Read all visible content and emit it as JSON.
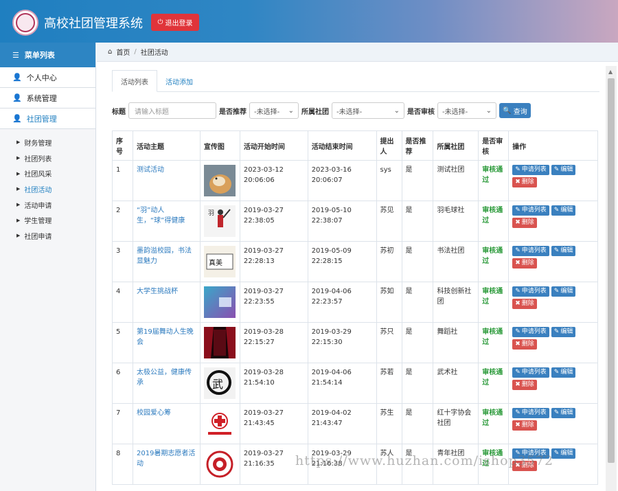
{
  "app": {
    "title": "高校社团管理系统",
    "logout_label": "退出登录"
  },
  "sidebar": {
    "header": "菜单列表",
    "groups": [
      {
        "label": "个人中心"
      },
      {
        "label": "系统管理"
      },
      {
        "label": "社团管理"
      }
    ],
    "sub_items": [
      "财务管理",
      "社团列表",
      "社团风采",
      "社团活动",
      "活动申请",
      "学生管理",
      "社团申请"
    ]
  },
  "breadcrumb": {
    "home": "首页",
    "current": "社团活动"
  },
  "tabs": [
    "活动列表",
    "活动添加"
  ],
  "filters": {
    "title_label": "标题",
    "title_placeholder": "请输入标题",
    "recommend_label": "是否推荐",
    "recommend_value": "-未选择-",
    "club_label": "所属社团",
    "club_value": "-未选择-",
    "audit_label": "是否审核",
    "audit_value": "-未选择-",
    "query_label": "查询"
  },
  "table": {
    "headers": [
      "序号",
      "活动主题",
      "宣传图",
      "活动开始时间",
      "活动结束时间",
      "提出人",
      "是否推荐",
      "所属社团",
      "是否审核",
      "操作"
    ],
    "rows": [
      {
        "no": "1",
        "topic": "测试活动",
        "start": "2023-03-12 20:06:06",
        "end": "2023-03-16 20:06:07",
        "proposer": "sys",
        "recommend": "是",
        "club": "测试社团",
        "audit": "审核通过"
      },
      {
        "no": "2",
        "topic": "“羽”动人生，“球”得健康",
        "start": "2019-03-27 22:38:05",
        "end": "2019-05-10 22:38:07",
        "proposer": "苏见",
        "recommend": "是",
        "club": "羽毛球社",
        "audit": "审核通过"
      },
      {
        "no": "3",
        "topic": "墨韵溢校园，书法显魅力",
        "start": "2019-03-27 22:28:13",
        "end": "2019-05-09 22:28:15",
        "proposer": "苏初",
        "recommend": "是",
        "club": "书法社团",
        "audit": "审核通过"
      },
      {
        "no": "4",
        "topic": "大学生挑战杯",
        "start": "2019-03-27 22:23:55",
        "end": "2019-04-06 22:23:57",
        "proposer": "苏如",
        "recommend": "是",
        "club": "科技创新社团",
        "audit": "审核通过"
      },
      {
        "no": "5",
        "topic": "第19届舞动人生晚会",
        "start": "2019-03-28 22:15:27",
        "end": "2019-03-29 22:15:30",
        "proposer": "苏只",
        "recommend": "是",
        "club": "舞蹈社",
        "audit": "审核通过"
      },
      {
        "no": "6",
        "topic": "太极公益，健康传承",
        "start": "2019-03-28 21:54:10",
        "end": "2019-04-06 21:54:14",
        "proposer": "苏若",
        "recommend": "是",
        "club": "武术社",
        "audit": "审核通过"
      },
      {
        "no": "7",
        "topic": "校园爱心筹",
        "start": "2019-03-27 21:43:45",
        "end": "2019-04-02 21:43:47",
        "proposer": "苏生",
        "recommend": "是",
        "club": "红十字协会社团",
        "audit": "审核通过"
      },
      {
        "no": "8",
        "topic": "2019暑期志愿者活动",
        "start": "2019-03-27 21:16:35",
        "end": "2019-03-29 21:16:38",
        "proposer": "苏人",
        "recommend": "是",
        "club": "青年社团",
        "audit": "审核通过"
      }
    ],
    "op_apply": "申请列表",
    "op_edit": "编辑",
    "op_delete": "删除"
  },
  "colors": {
    "header_start": "#1f7fc0",
    "accent": "#2d85c3",
    "danger": "#d9534f",
    "success": "#2b9a3a"
  },
  "watermark": "https://www.huzhan.com/ishop3572"
}
